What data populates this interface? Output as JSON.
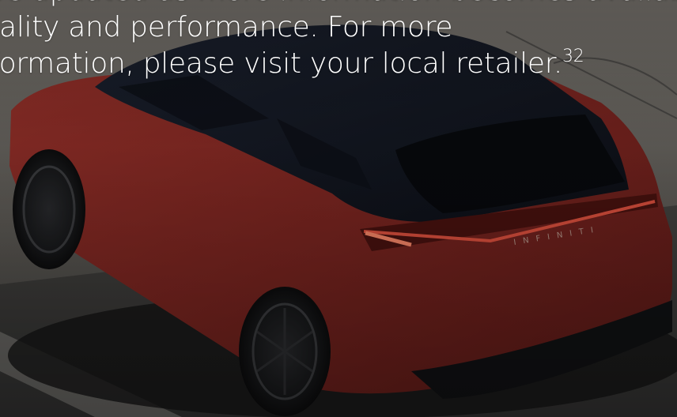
{
  "hero": {
    "caption": {
      "line1": "ll be updated as more information becomes available, ensuring",
      "line2": "quality and performance. For more",
      "line3": "information, please visit your local retailer.",
      "footnote": "32"
    },
    "image": {
      "subject": "red-suv-rear-three-quarter-view",
      "badge_text": "INFINITI"
    }
  },
  "colors": {
    "body_red": "#8a2a25",
    "roof_black": "#141820",
    "text": "#ffffff"
  }
}
